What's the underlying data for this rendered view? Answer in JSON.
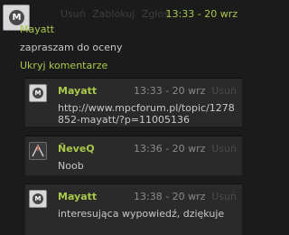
{
  "main_comment": {
    "avatar_letter": "M",
    "actions": [
      "Usuń",
      "Zablokuj",
      "Zgłoś"
    ],
    "meta": "13:33 - 20 wrz",
    "author": "Mayatt",
    "text": "zapraszam do oceny",
    "hide_label": "Ukryj komentarze"
  },
  "replies": [
    {
      "avatar_letter": "M",
      "author": "Mayatt",
      "time": "13:33 - 20 wrz",
      "remove_label": "Usuń",
      "text": "http://www.mpcforum.pl/topic/1278852-mayatt/?p=11005136"
    },
    {
      "avatar_letter": "",
      "author": "ŇeveQ",
      "time": "13:36 - 20 wrz",
      "remove_label": "Usuń",
      "text": "Noob"
    },
    {
      "avatar_letter": "M",
      "author": "Mayatt",
      "time": "13:38 - 20 wrz",
      "remove_label": "Usuń",
      "text": "interesująca wypowiedź, dziękuje"
    }
  ]
}
